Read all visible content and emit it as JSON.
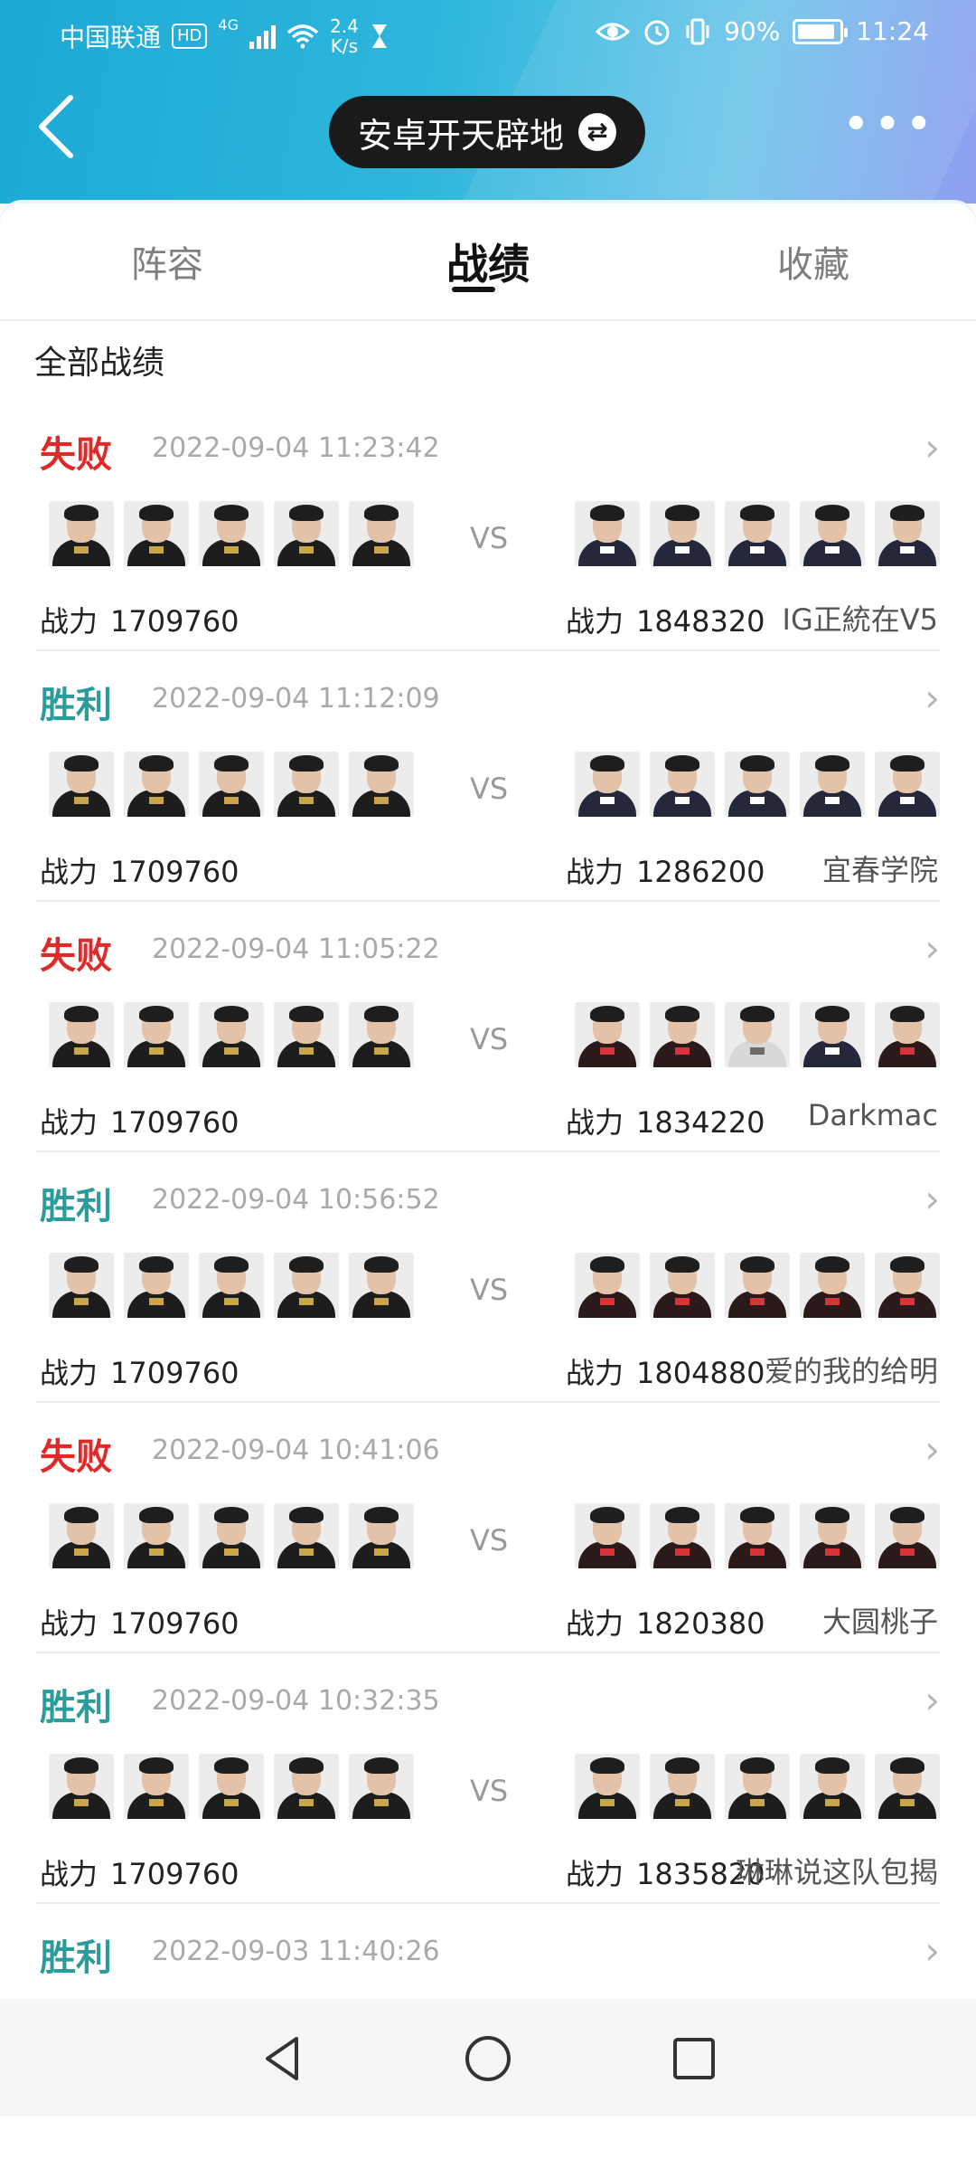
{
  "status_bar": {
    "carrier": "中国联通",
    "hd": "HD",
    "net_type": "4G",
    "net_speed_value": "2.4",
    "net_speed_unit": "K/s",
    "battery_percent": "90%",
    "battery_level": 0.9,
    "time": "11:24"
  },
  "header": {
    "back_glyph": "<",
    "account_name": "安卓开天辟地",
    "swap_glyph": "⇄",
    "more_glyph": "•••"
  },
  "tabs": [
    {
      "label": "阵容",
      "active": false
    },
    {
      "label": "战绩",
      "active": true
    },
    {
      "label": "收藏",
      "active": false
    }
  ],
  "section_title": "全部战绩",
  "power_label": "战力",
  "vs_label": "VS",
  "chevron_glyph": "›",
  "matches": [
    {
      "result": "失败",
      "outcome": "lose",
      "time": "2022-09-04 11:23:42",
      "my_power": "1709760",
      "opp_power": "1848320",
      "opp_name": "IG正統在V5"
    },
    {
      "result": "胜利",
      "outcome": "win",
      "time": "2022-09-04 11:12:09",
      "my_power": "1709760",
      "opp_power": "1286200",
      "opp_name": "宜春学院"
    },
    {
      "result": "失败",
      "outcome": "lose",
      "time": "2022-09-04 11:05:22",
      "my_power": "1709760",
      "opp_power": "1834220",
      "opp_name": "Darkmac"
    },
    {
      "result": "胜利",
      "outcome": "win",
      "time": "2022-09-04 10:56:52",
      "my_power": "1709760",
      "opp_power": "1804880",
      "opp_name": "爱的我的给明"
    },
    {
      "result": "失败",
      "outcome": "lose",
      "time": "2022-09-04 10:41:06",
      "my_power": "1709760",
      "opp_power": "1820380",
      "opp_name": "大圆桃子"
    },
    {
      "result": "胜利",
      "outcome": "win",
      "time": "2022-09-04 10:32:35",
      "my_power": "1709760",
      "opp_power": "1835820",
      "opp_name": "琳琳说这队包揭"
    },
    {
      "result": "胜利",
      "outcome": "win",
      "time": "2022-09-03 11:40:26"
    }
  ],
  "colors": {
    "lose": "#e02a2a",
    "win": "#2a9c9c",
    "header_start": "#1ba9d6",
    "header_end": "#8f9ff0"
  },
  "icons": {
    "status": [
      "hd-badge-icon",
      "signal-bars-icon",
      "wifi-icon",
      "hourglass-icon",
      "eye-icon",
      "alarm-icon",
      "vibrate-icon",
      "battery-icon"
    ],
    "nav": [
      "triangle-back-icon",
      "circle-home-icon",
      "square-recent-icon"
    ]
  }
}
